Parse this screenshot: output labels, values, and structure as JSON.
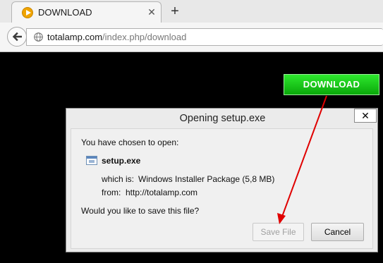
{
  "browser": {
    "tab": {
      "title": "DOWNLOAD"
    },
    "new_tab_label": "+",
    "tab_close_label": "✕",
    "address_bar": {
      "host": "totalamp.com",
      "path": "/index.php/download"
    }
  },
  "page": {
    "download_button_label": "DOWNLOAD"
  },
  "dialog": {
    "title": "Opening setup.exe",
    "close_label": "✕",
    "intro": "You have chosen to open:",
    "file_name": "setup.exe",
    "which_is_label": "which is:",
    "which_is_value": "Windows Installer Package (5,8 MB)",
    "from_label": "from:",
    "from_value": "http://totalamp.com",
    "question": "Would you like to save this file?",
    "save_label": "Save File",
    "cancel_label": "Cancel"
  },
  "colors": {
    "download_green": "#1fc41f",
    "arrow_red": "#e00000"
  },
  "icons": [
    "favicon-icon",
    "close-icon",
    "back-arrow-icon",
    "globe-icon",
    "file-icon"
  ]
}
